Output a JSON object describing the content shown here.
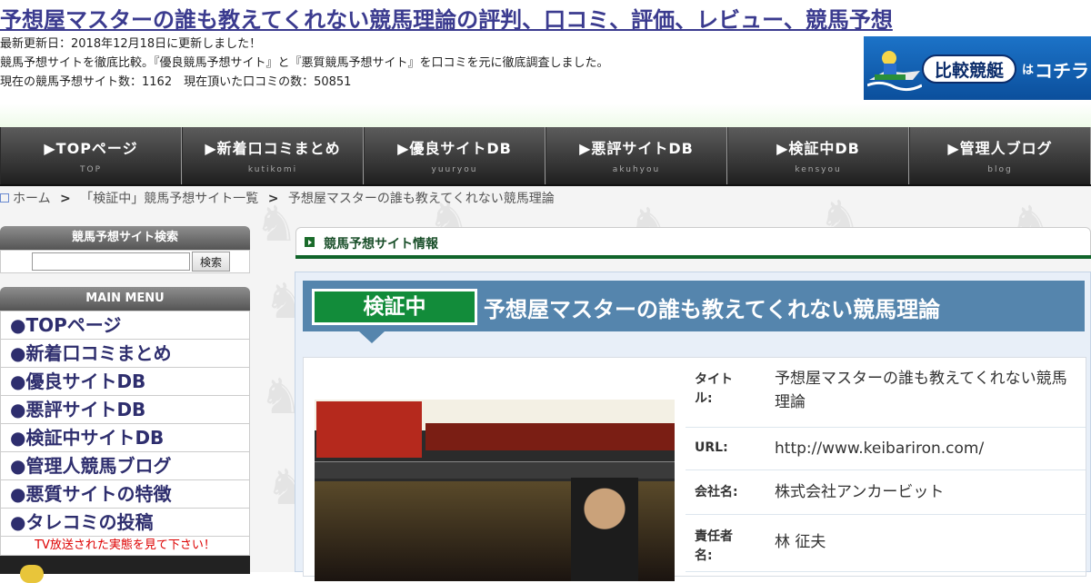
{
  "site_title": "予想屋マスターの誰も教えてくれない競馬理論の評判、口コミ、評価、レビュー、競馬予想",
  "header_lines": {
    "updated": "最新更新日：2018年12月18日に更新しました！",
    "intro": "競馬予想サイトを徹底比較。『優良競馬予想サイト』と『悪質競馬予想サイト』を口コミを元に徹底調査しました。",
    "counts": "現在の競馬予想サイト数：1162　現在頂いた口コミの数：50851"
  },
  "banner": {
    "pill": "比較競艇",
    "ha": "は",
    "kochira": "コチラ"
  },
  "nav": [
    {
      "label": "▶TOPページ",
      "sub": "TOP"
    },
    {
      "label": "▶新着口コミまとめ",
      "sub": "kutikomi"
    },
    {
      "label": "▶優良サイトDB",
      "sub": "yuuryou"
    },
    {
      "label": "▶悪評サイトDB",
      "sub": "akuhyou"
    },
    {
      "label": "▶検証中DB",
      "sub": "kensyou"
    },
    {
      "label": "▶管理人ブログ",
      "sub": "blog"
    }
  ],
  "breadcrumb": {
    "home": "ホーム",
    "sep": ">",
    "list": "「検証中」競馬予想サイト一覧",
    "current": "予想屋マスターの誰も教えてくれない競馬理論"
  },
  "sidebar": {
    "search_title": "競馬予想サイト検索",
    "search_placeholder": "",
    "search_button": "検索",
    "menu_title": "MAIN MENU",
    "menu_items": [
      "●TOPページ",
      "●新着口コミまとめ",
      "●優良サイトDB",
      "●悪評サイトDB",
      "●検証中サイトDB",
      "●管理人競馬ブログ",
      "●悪質サイトの特徴",
      "●タレコミの投稿"
    ],
    "tv_note": "TV放送された実態を見て下さい！"
  },
  "main": {
    "tab_title": "競馬予想サイト情報",
    "badge": "検証中",
    "heading": "予想屋マスターの誰も教えてくれない競馬理論",
    "info": [
      {
        "key": "タイトル:",
        "value": "予想屋マスターの誰も教えてくれない競馬理論"
      },
      {
        "key": "URL:",
        "value": "http://www.keibariron.com/"
      },
      {
        "key": "会社名:",
        "value": "株式会社アンカービット"
      },
      {
        "key": "責任者名:",
        "value": "林 征夫"
      }
    ]
  },
  "colors": {
    "title_link": "#3b3b8f",
    "nav_bg": "#2e2e2e",
    "badge_green": "#128c3a",
    "title_bar": "#5585ad",
    "tv_note_red": "#dd0000"
  }
}
